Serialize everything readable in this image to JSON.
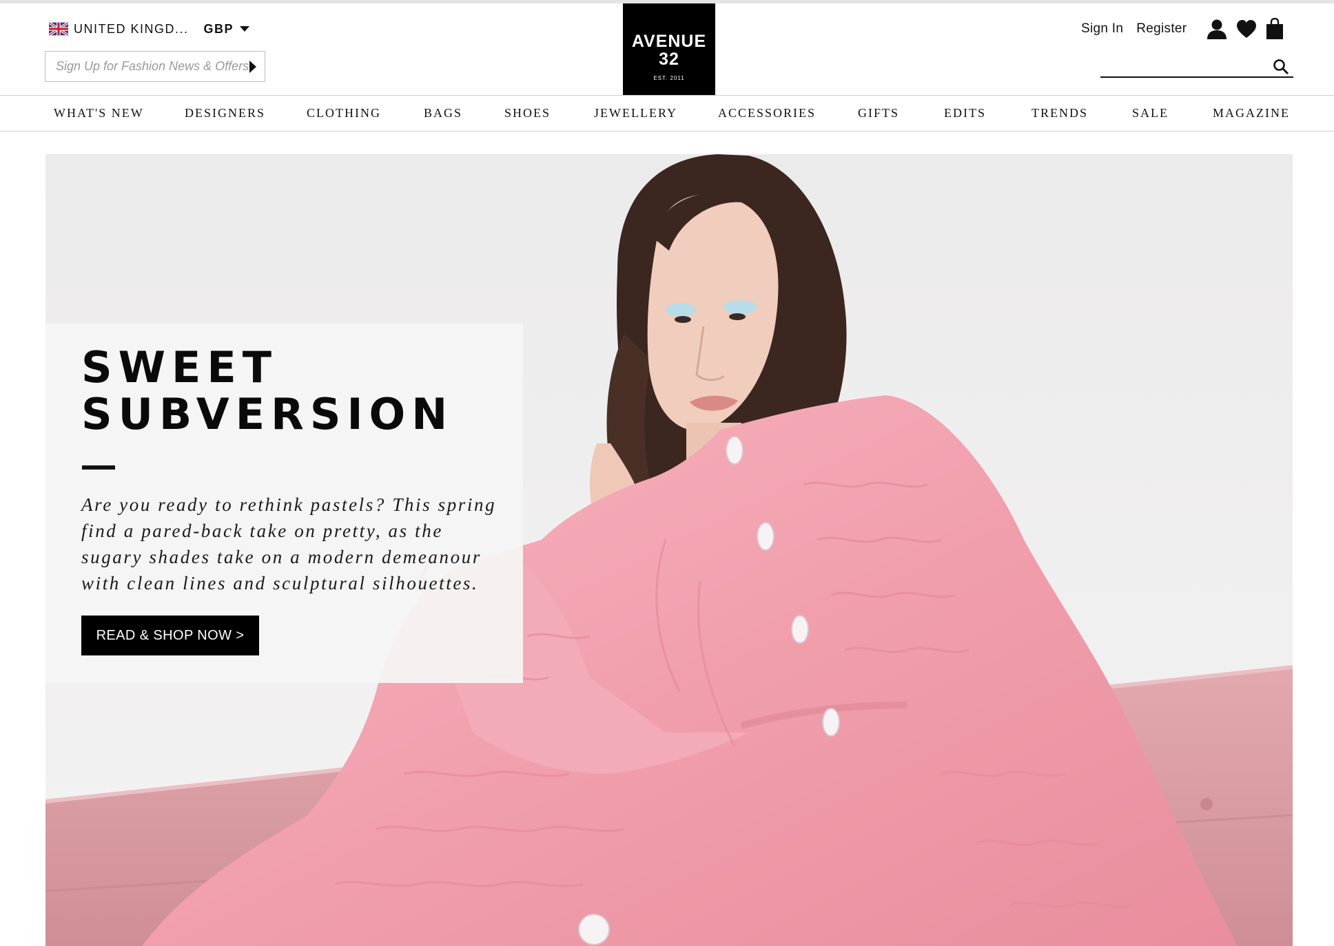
{
  "header": {
    "country": "UNITED KINGD...",
    "currency": "GBP",
    "newsletter_placeholder": "Sign Up for Fashion News & Offers",
    "logo": {
      "line1": "AVENUE",
      "line2": "32",
      "line3": "EST. 2011"
    },
    "sign_in": "Sign In",
    "register": "Register",
    "icons": [
      "user-icon",
      "heart-icon",
      "bag-icon",
      "search-icon"
    ]
  },
  "nav": {
    "items": [
      "WHAT'S NEW",
      "DESIGNERS",
      "CLOTHING",
      "BAGS",
      "SHOES",
      "JEWELLERY",
      "ACCESSORIES",
      "GIFTS",
      "EDITS",
      "TRENDS",
      "SALE",
      "MAGAZINE"
    ]
  },
  "hero": {
    "title": "SWEET SUBVERSION",
    "body": "Are you ready to rethink pastels? This spring find a pared-back take on pretty, as the sugary shades take on a modern demeanour with clean lines and sculptural silhouettes.",
    "cta": "READ & SHOP NOW >"
  },
  "colors": {
    "brand": "#000000",
    "hero_pink": "#f2a5b1",
    "sofa_pink": "#d99ca3"
  }
}
